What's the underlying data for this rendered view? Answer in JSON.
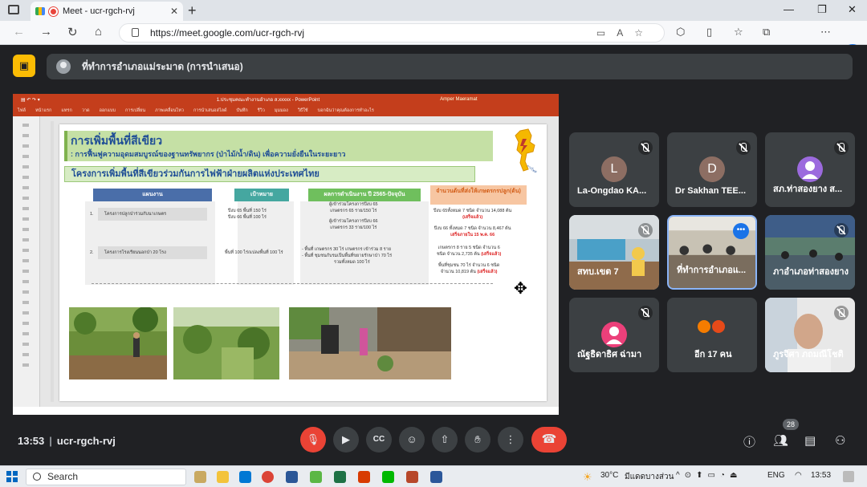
{
  "browser": {
    "tab_title": "Meet - ucr-rgch-rvj",
    "url": "https://meet.google.com/ucr-rgch-rvj"
  },
  "meet": {
    "presenter_banner": "ที่ทำการอำเภอแม่ระมาด (การนำเสนอ)",
    "meeting_time": "13:53",
    "meeting_code": "ucr-rgch-rvj",
    "participant_count": "28",
    "tiles": [
      {
        "name": "La-Ongdao KA...",
        "initial": "L",
        "color": "#8d6e63",
        "type": "avatar"
      },
      {
        "name": "Dr Sakhan TEE...",
        "initial": "D",
        "color": "#8d6e63",
        "type": "avatar"
      },
      {
        "name": "สภ.ท่าสองยาง ส...",
        "initial": "",
        "color": "#9c6ade",
        "type": "avatar"
      },
      {
        "name": "สทบ.เขต 7",
        "type": "video"
      },
      {
        "name": "ที่ทำการอำเภอแ...",
        "type": "video"
      },
      {
        "name": "ภาอำเภอท่าสองยาง",
        "type": "video"
      },
      {
        "name": "ณัฐธิดาธิศ ฉ่ามา",
        "initial": "",
        "color": "#ec407a",
        "type": "avatar"
      },
      {
        "name": "อีก 17 คน",
        "type": "group"
      },
      {
        "name": "ภูรจิศา ภถมณีโชติ",
        "type": "video"
      }
    ]
  },
  "slide": {
    "ppt_file": "1.ประชุมคณะทำงานอำเภอ ส.xxxxx - PowerPoint",
    "ppt_user": "Amper Maeramat",
    "ribbon": [
      "ไฟล์",
      "หน้าแรก",
      "แทรก",
      "วาด",
      "ออกแบบ",
      "การเปลี่ยน",
      "ภาพเคลื่อนไหว",
      "การนำเสนอสไลด์",
      "บันทึก",
      "รีวิว",
      "มุมมอง",
      "วิธีใช้",
      "บอกฉันว่าคุณต้องการทำอะไร"
    ],
    "title": "การเพิ่มพื้นที่สีเขียว",
    "subtitle": ": การฟื้นฟูความอุดมสมบูรณ์ของฐานทรัพยากร (ป่าไม้/น้ำ/ดิน) เพื่อความยั่งยืนในระยะยาว",
    "project": "โครงการเพิ่มพื้นที่สีเขียวร่วมกันการไฟฟ้าฝ่ายผลิตแห่งประเทศไทย",
    "logo_text": "การไฟฟ้าฝ่ายผลิตแห่งประเทศไทย",
    "headers": [
      "แผนงาน",
      "เป้าหมาย",
      "ผลการดำเนินงาน ปี 2565-ปัจจุบัน",
      "จำนวนต้นที่ส่งให้เกษตรกรปลูก(ต้น)"
    ],
    "row1": {
      "no": "1.",
      "plan": "โครงการปลูกป่าร่วมกับนาเกษตร",
      "target1": "ปีงบ 65 พื้นที่ 150 ไร่",
      "target2": "ปีงบ 66 พื้นที่  100 ไร่",
      "result1": "ผู้เข้าร่วมโครงการปีงบ 65",
      "result2": "เกษตรกร  65  ราย/150 ไร่",
      "result3": "ผู้เข้าร่วมโครงการปีงบ 66",
      "result4": "เกษตรกร  33  ราย/100 ไร่",
      "trees1": "ปีงบ 65ทั้งหมด 7 ชนิด จำนวน 14,088 ต้น",
      "trees1s": "(เสร็จแล้ว)",
      "trees2": "ปีงบ 66 ทั้งหมด 7 ชนิด จำนวน 8,467  ต้น",
      "trees2s": "เสร็จภายใน 15 พ.ค. 66"
    },
    "row2": {
      "no": "2.",
      "plan": "โครงการโรงเรียนนอกป่า 20 โรง",
      "target": "พื้นที่ 100 ไร่/แปลงพื้นที่ 100 ไร่",
      "result1": "- พื้นที่ เกษตรกร 30 ไร่ เกษตรกร เข้าร่วม 8 ราย",
      "result2": "- พื้นที่ ชุมชนกับรมเป็นพื้นที่ขยายรักษาป่า 70 ไร่",
      "result3": "รวมทั้งหมด 100 ไร่",
      "trees1": "เกษตรกร 8 ราย  5 ชนิด จำนวน 6",
      "trees2": "ชนิด จำนวน 2,735 ต้น",
      "trees2s": "(เสร็จแล้ว)",
      "trees3": "พื้นที่ชุมชน 70 ไร่ จำนวน 6 ชนิด",
      "trees4": "จำนวน 10,819 ต้น",
      "trees4s": "(เสร็จแล้ว)"
    }
  },
  "taskbar": {
    "search": "Search",
    "weather": "30°C",
    "weather_desc": "มีแดดบางส่วน",
    "lang": "ENG",
    "time": "13:53"
  }
}
